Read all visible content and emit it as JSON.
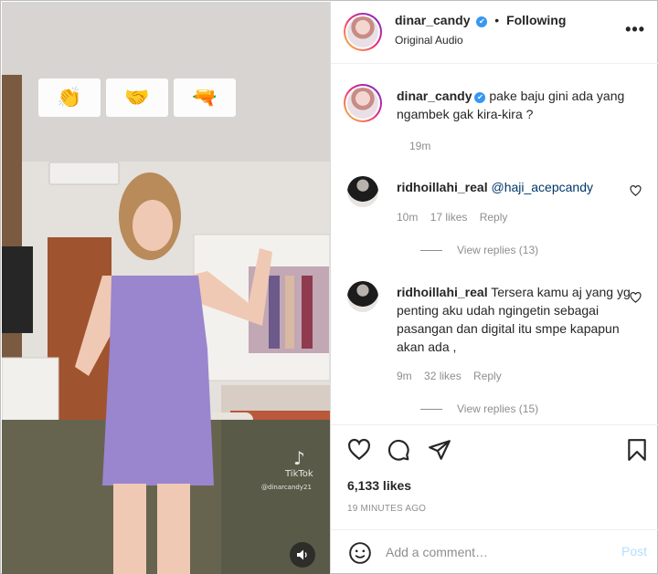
{
  "media": {
    "emojis": [
      "👏",
      "🤝",
      "🔫"
    ],
    "watermark": "TikTok",
    "watermark_handle": "@dinarcandy21"
  },
  "header": {
    "username": "dinar_candy",
    "verified_glyph": "✔",
    "separator": "•",
    "following": "Following",
    "audio": "Original Audio",
    "more": "•••"
  },
  "caption": {
    "username": "dinar_candy",
    "text": "pake baju gini ada yang ngambek gak kira-kira ?",
    "time": "19m"
  },
  "comments": [
    {
      "username": "ridhoillahi_real",
      "mention": "@haji_acepcandy",
      "text": "",
      "time": "10m",
      "likes": "17 likes",
      "reply": "Reply",
      "view_replies": "View replies (13)"
    },
    {
      "username": "ridhoillahi_real",
      "mention": "",
      "text": "Tersera kamu aj yang yg penting aku udah ngingetin sebagai pasangan dan digital itu smpe kapapun akan ada ,",
      "time": "9m",
      "likes": "32 likes",
      "reply": "Reply",
      "view_replies": "View replies (15)"
    }
  ],
  "actions": {
    "likes": "6,133 likes",
    "posted": "19 MINUTES AGO"
  },
  "add_comment": {
    "placeholder": "Add a comment…",
    "post": "Post"
  },
  "colors": {
    "verified": "#3897f0",
    "dress": "#9a86cf",
    "post_disabled": "#b2dffc",
    "link": "#00376b"
  }
}
